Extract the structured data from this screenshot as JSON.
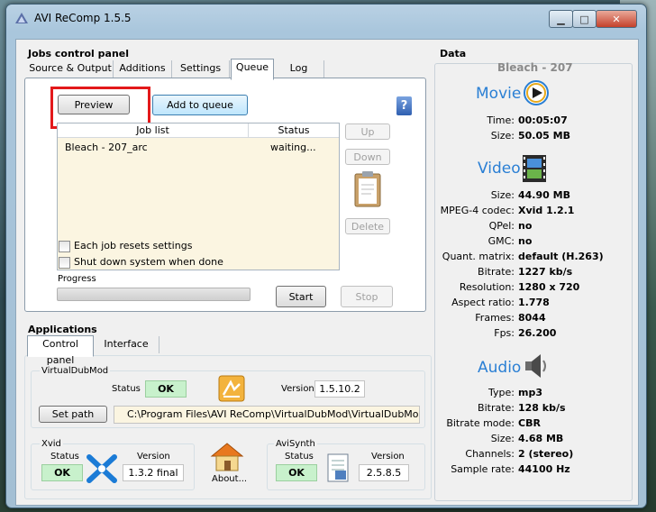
{
  "window": {
    "title": "AVI ReComp  1.5.5"
  },
  "jobs": {
    "panel_title": "Jobs control panel",
    "tabs": [
      "Source & Output",
      "Additions",
      "Settings",
      "Queue",
      "Log"
    ],
    "active_tab": "Queue",
    "preview_label": "Preview",
    "add_to_queue_label": "Add to queue",
    "col_job": "Job list",
    "col_status": "Status",
    "rows": [
      {
        "name": "Bleach - 207_arc",
        "status": "waiting..."
      }
    ],
    "up_label": "Up",
    "down_label": "Down",
    "delete_label": "Delete",
    "each_job_resets": "Each job resets settings",
    "shutdown_label": "Shut down system when done",
    "progress_label": "Progress",
    "progress_value": 0,
    "start_label": "Start",
    "stop_label": "Stop"
  },
  "applications": {
    "title": "Applications",
    "tabs": [
      "Control panel",
      "Interface"
    ],
    "vdm": {
      "group_title": "VirtualDubMod",
      "status_label": "Status",
      "status_value": "OK",
      "version_label": "Version",
      "version_value": "1.5.10.2",
      "set_path_label": "Set path",
      "path_value": "C:\\Program Files\\AVI ReComp\\VirtualDubMod\\VirtualDubMod.exe"
    },
    "xvid": {
      "group_title": "Xvid",
      "status_label": "Status",
      "status_value": "OK",
      "version_label": "Version",
      "version_value": "1.3.2 final"
    },
    "about_label": "About...",
    "avisynth": {
      "group_title": "AviSynth",
      "status_label": "Status",
      "status_value": "OK",
      "version_label": "Version",
      "version_value": "2.5.8.5"
    }
  },
  "data": {
    "title": "Data",
    "file_name": "Bleach - 207",
    "movie_heading": "Movie",
    "movie": [
      {
        "label": "Time:",
        "value": "00:05:07"
      },
      {
        "label": "Size:",
        "value": "50.05 MB"
      }
    ],
    "video_heading": "Video",
    "video": [
      {
        "label": "Size:",
        "value": "44.90 MB"
      },
      {
        "label": "MPEG-4 codec:",
        "value": "Xvid 1.2.1"
      },
      {
        "label": "QPel:",
        "value": "no"
      },
      {
        "label": "GMC:",
        "value": "no"
      },
      {
        "label": "Quant. matrix:",
        "value": "default (H.263)"
      },
      {
        "label": "Bitrate:",
        "value": "1227 kb/s"
      },
      {
        "label": "Resolution:",
        "value": "1280 x 720"
      },
      {
        "label": "Aspect ratio:",
        "value": "1.778"
      },
      {
        "label": "Frames:",
        "value": "8044"
      },
      {
        "label": "Fps:",
        "value": "26.200"
      }
    ],
    "audio_heading": "Audio",
    "audio": [
      {
        "label": "Type:",
        "value": "mp3"
      },
      {
        "label": "Bitrate:",
        "value": "128 kb/s"
      },
      {
        "label": "Bitrate mode:",
        "value": "CBR"
      },
      {
        "label": "Size:",
        "value": "4.68 MB"
      },
      {
        "label": "Channels:",
        "value": "2 (stereo)"
      },
      {
        "label": "Sample rate:",
        "value": "44100 Hz"
      }
    ]
  },
  "colors": {
    "accent": "#2a7fd4",
    "highlight": "#e3191b",
    "ok": "#c8f1cc"
  }
}
